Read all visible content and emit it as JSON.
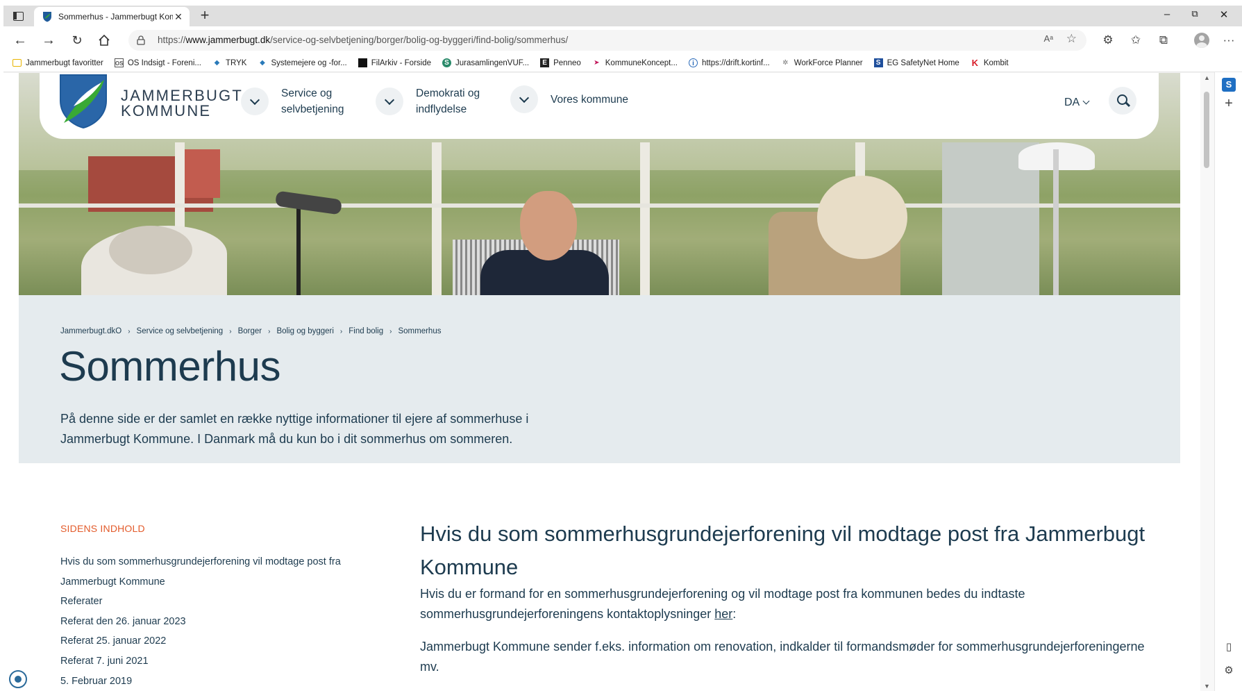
{
  "browser": {
    "tab_title": "Sommerhus - Jammerbugt Komm",
    "url_prefix": "https://",
    "url_host": "www.jammerbugt.dk",
    "url_path": "/service-og-selvbetjening/borger/bolig-og-byggeri/find-bolig/sommerhus/",
    "read_aloud": "Aᵃ",
    "favorites": [
      {
        "label": "Jammerbugt favoritter",
        "icon": "folder-icon",
        "color": "#e8b400"
      },
      {
        "label": "OS Indsigt - Foreni...",
        "icon": "os-icon",
        "color": "#555555"
      },
      {
        "label": "TRYK",
        "icon": "shield-icon",
        "color": "#2a7ab9"
      },
      {
        "label": "Systemejere og -for...",
        "icon": "shield-icon",
        "color": "#2a7ab9"
      },
      {
        "label": "FilArkiv - Forside",
        "icon": "filarkiv-icon",
        "color": "#111111"
      },
      {
        "label": "JurasamlingenVUF...",
        "icon": "s-icon",
        "color": "#2a8a6a"
      },
      {
        "label": "Penneo",
        "icon": "e-icon",
        "color": "#222222"
      },
      {
        "label": "KommuneKoncept...",
        "icon": "kk-icon",
        "color": "#c2185b"
      },
      {
        "label": "https://drift.kortinf...",
        "icon": "globe-icon",
        "color": "#2a6ab9"
      },
      {
        "label": "WorkForce Planner",
        "icon": "gear-icon",
        "color": "#777777"
      },
      {
        "label": "EG SafetyNet Home",
        "icon": "s-box-icon",
        "color": "#1f4f9c"
      },
      {
        "label": "Kombit",
        "icon": "k-icon",
        "color": "#d81e2b"
      }
    ]
  },
  "site": {
    "logo_line1": "JAMMERBUGT",
    "logo_line2": "KOMMUNE",
    "nav": [
      "Service og selvbetjening",
      "Demokrati og indflydelse",
      "Vores kommune"
    ],
    "language": "DA"
  },
  "breadcrumb": [
    "Jammerbugt.dkO",
    "Service og selvbetjening",
    "Borger",
    "Bolig og byggeri",
    "Find bolig",
    "Sommerhus"
  ],
  "page": {
    "title": "Sommerhus",
    "lead": "På denne side er der samlet en række nyttige informationer til ejere af sommerhuse i Jammerbugt Kommune. I Danmark må du kun bo i dit sommerhus om sommeren."
  },
  "toc": {
    "heading": "SIDENS INDHOLD",
    "items": [
      "Hvis du som sommerhusgrundejerforening vil modtage post fra Jammerbugt Kommune",
      "Referater",
      "Referat den 26. januar 2023",
      "Referat 25. januar 2022",
      "Referat 7. juni 2021",
      "5. Februar 2019"
    ]
  },
  "article": {
    "heading": "Hvis du som sommerhusgrundejerforening vil modtage post fra Jammerbugt Kommune",
    "p1_text": "Hvis du er formand for en sommerhusgrundejerforening og vil modtage post fra kommunen bedes du indtaste sommerhusgrundejerforeningens kontaktoplysninger ",
    "p1_link": "her",
    "p1_end": ":",
    "p2": "Jammerbugt Kommune sender f.eks. information om renovation, indkalder til formandsmøder for sommerhusgrundejerforeningerne mv."
  },
  "colors": {
    "brand_dark": "#1d3b4f",
    "accent_orange": "#e35b2b",
    "band_bg": "#e5ebee",
    "logo_green": "#39a935",
    "logo_blue": "#1f5a9a"
  }
}
